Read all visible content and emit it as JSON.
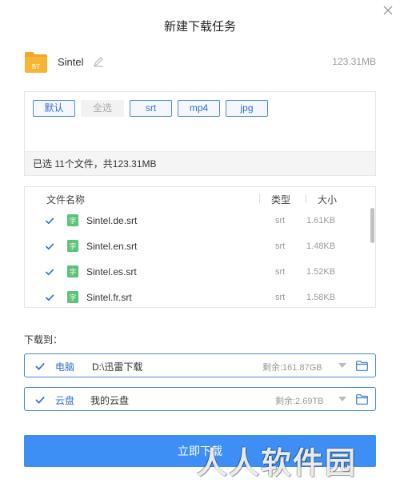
{
  "dialog": {
    "title": "新建下载任务"
  },
  "task": {
    "name": "Sintel",
    "size": "123.31MB",
    "icon_text": "BT"
  },
  "filters": {
    "buttons": [
      {
        "label": "默认",
        "state": "active"
      },
      {
        "label": "全选",
        "state": "disabled"
      },
      {
        "label": "srt",
        "state": "active"
      },
      {
        "label": "mp4",
        "state": "active"
      },
      {
        "label": "jpg",
        "state": "active"
      }
    ],
    "status": "已选 11个文件，共123.31MB"
  },
  "file_list": {
    "headers": {
      "name": "文件名称",
      "type": "类型",
      "size": "大小"
    },
    "files": [
      {
        "name": "Sintel.de.srt",
        "type": "srt",
        "size": "1.61KB",
        "checked": true,
        "icon_text": "字"
      },
      {
        "name": "Sintel.en.srt",
        "type": "srt",
        "size": "1.48KB",
        "checked": true,
        "icon_text": "字"
      },
      {
        "name": "Sintel.es.srt",
        "type": "srt",
        "size": "1.52KB",
        "checked": true,
        "icon_text": "字"
      },
      {
        "name": "Sintel.fr.srt",
        "type": "srt",
        "size": "1.58KB",
        "checked": true,
        "icon_text": "字"
      }
    ]
  },
  "destination": {
    "label": "下载到：",
    "options": [
      {
        "name": "电脑",
        "path": "D:\\迅雷下载",
        "free": "剩余:161.87GB",
        "checked": true
      },
      {
        "name": "云盘",
        "path": "我的云盘",
        "free": "剩余:2.69TB",
        "checked": true
      }
    ]
  },
  "actions": {
    "download_label": "立即下载"
  },
  "watermark": "人人软件园",
  "colors": {
    "accent": "#3d8ff5",
    "link_blue": "#2f6fd0",
    "folder_orange": "#f5a623",
    "subtitle_green": "#5cc476"
  }
}
